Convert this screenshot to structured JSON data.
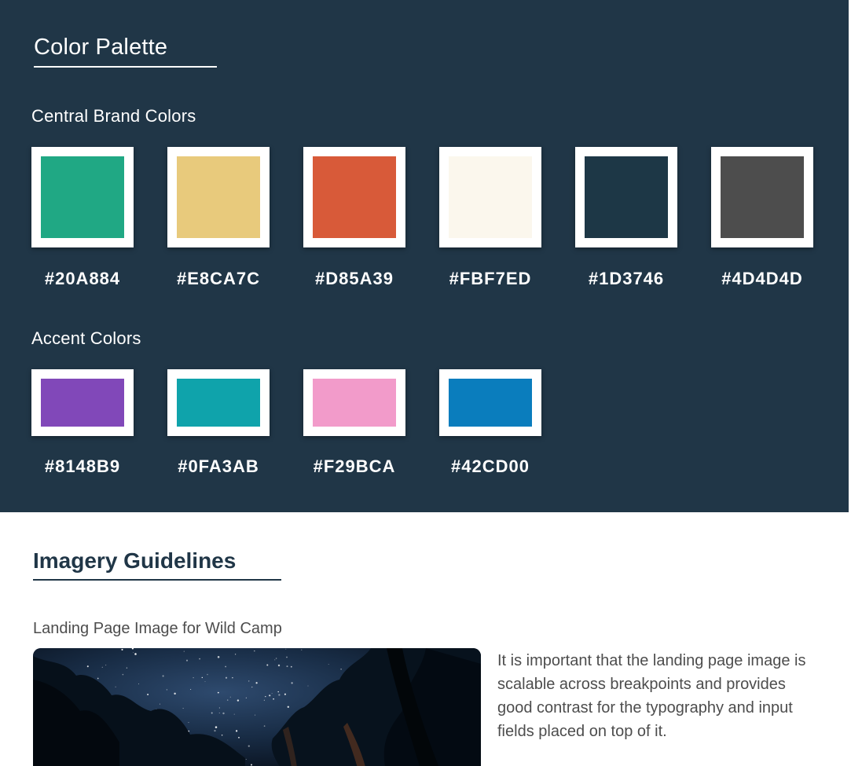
{
  "palette": {
    "title": "Color Palette",
    "central": {
      "heading": "Central Brand Colors",
      "swatches": [
        {
          "hex": "#20A884",
          "color": "#20A884"
        },
        {
          "hex": "#E8CA7C",
          "color": "#E8CA7C"
        },
        {
          "hex": "#D85A39",
          "color": "#D85A39"
        },
        {
          "hex": "#FBF7ED",
          "color": "#FBF7ED"
        },
        {
          "hex": "#1D3746",
          "color": "#1D3746"
        },
        {
          "hex": "#4D4D4D",
          "color": "#4D4D4D"
        }
      ]
    },
    "accent": {
      "heading": "Accent Colors",
      "swatches": [
        {
          "hex": "#8148B9",
          "color": "#8148B9"
        },
        {
          "hex": "#0FA3AB",
          "color": "#0FA3AB"
        },
        {
          "hex": "#F29BCA",
          "color": "#F29BCA"
        },
        {
          "hex": "#42CD00",
          "color": "#0A7DBD"
        }
      ]
    },
    "background_color": "#203647"
  },
  "imagery": {
    "title": "Imagery Guidelines",
    "caption": "Landing Page Image for Wild Camp",
    "image_icon": "night-sky-forest-photo",
    "description": "It is important that the landing page image is scalable across breakpoints and provides good contrast for the typography and input fields placed on top of it."
  }
}
